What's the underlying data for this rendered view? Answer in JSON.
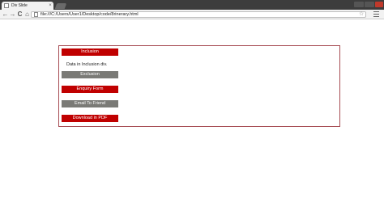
{
  "browser": {
    "tab_title": "Div Slide",
    "tab_close": "×",
    "url": "file:///C:/Users/User1/Desktop/code/8rinerary.html",
    "back": "←",
    "forward": "→",
    "reload": "C",
    "home": "⌂",
    "star": "☆"
  },
  "page": {
    "buttons": {
      "inclusion": "Inclusion",
      "exclusion": "Exclusion",
      "enquiry": "Enquiry Form",
      "email": "Email To Friend",
      "download": "Download in PDF"
    },
    "inclusion_text": "Data in Inclusion div."
  },
  "colors": {
    "accent_red": "#c00000",
    "gray_button": "#7a7a76",
    "border": "#a64b52"
  }
}
